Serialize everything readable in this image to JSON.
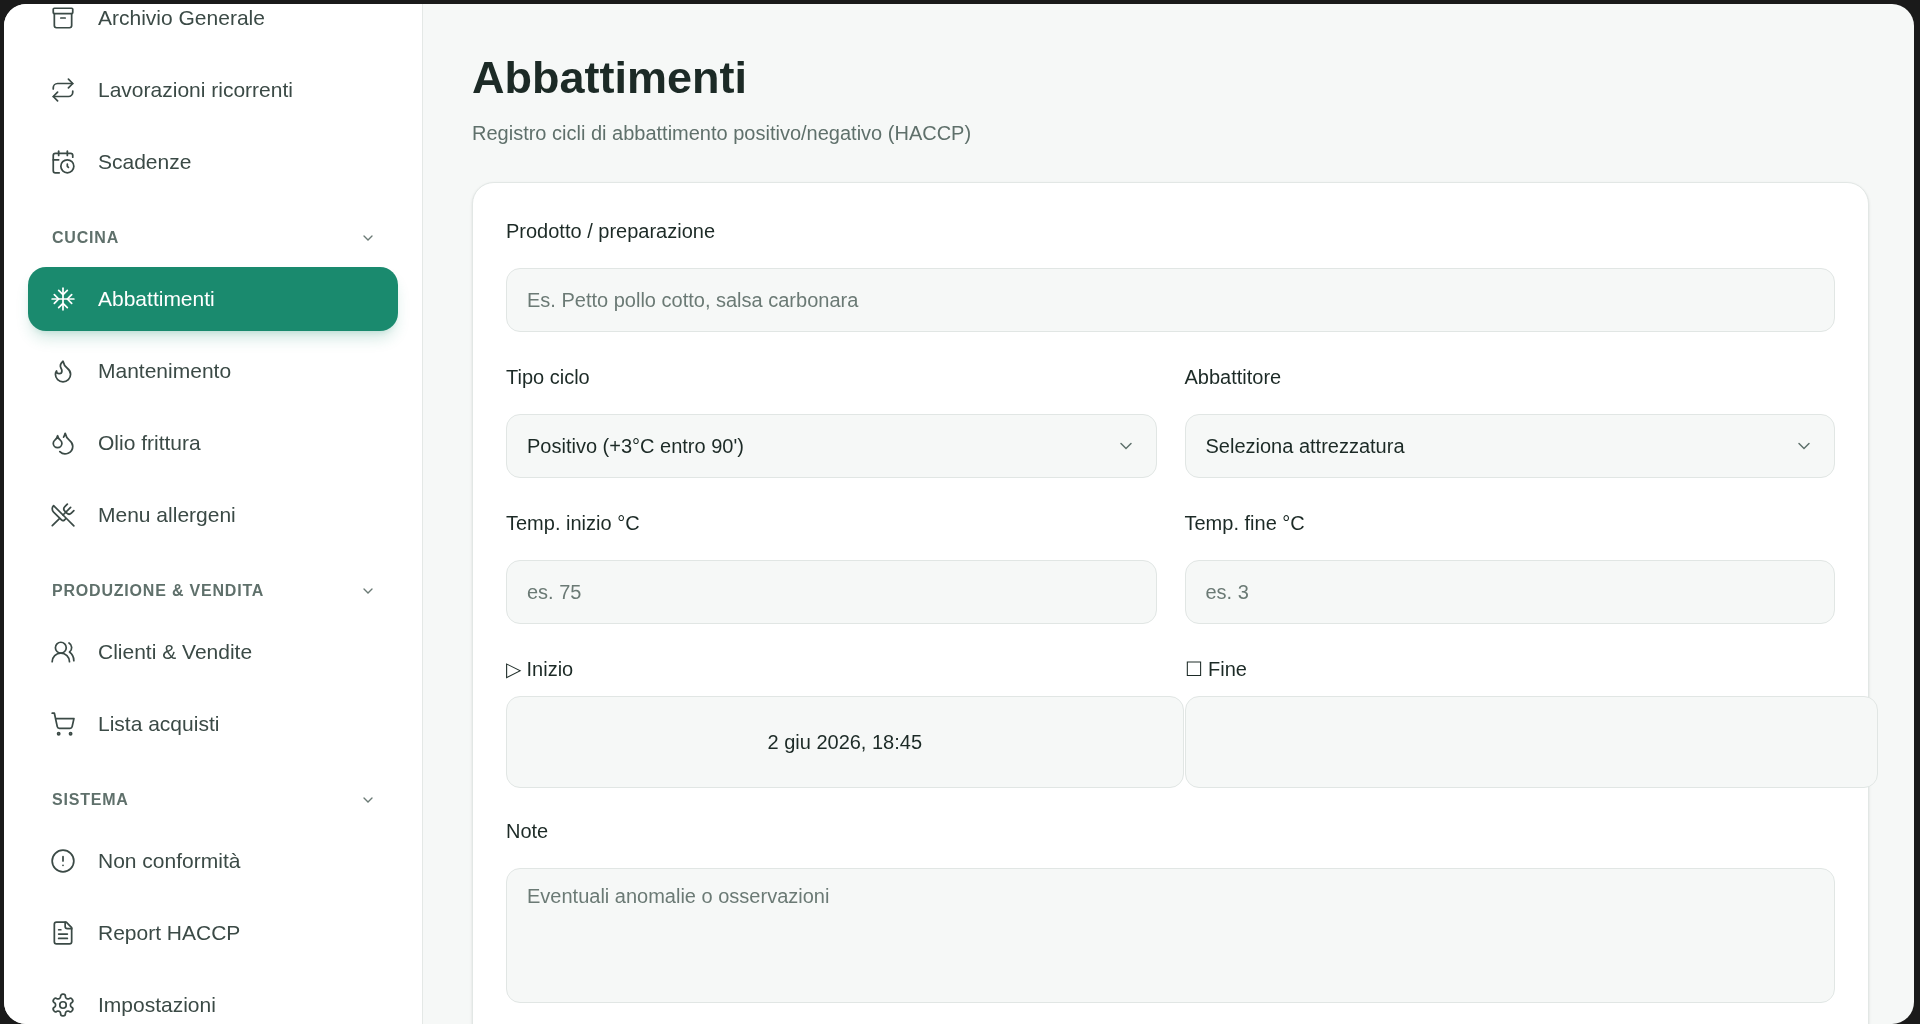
{
  "sidebar": {
    "items": [
      {
        "label": "Archivio Generale",
        "selected": false
      },
      {
        "label": "Lavorazioni ricorrenti",
        "selected": false
      },
      {
        "label": "Scadenze",
        "selected": false
      }
    ],
    "sections": [
      {
        "title": "CUCINA",
        "expanded": true,
        "items": [
          {
            "label": "Abbattimenti",
            "selected": true
          },
          {
            "label": "Mantenimento",
            "selected": false
          },
          {
            "label": "Olio frittura",
            "selected": false
          },
          {
            "label": "Menu allergeni",
            "selected": false
          }
        ]
      },
      {
        "title": "PRODUZIONE & VENDITA",
        "expanded": true,
        "items": [
          {
            "label": "Clienti & Vendite",
            "selected": false
          },
          {
            "label": "Lista acquisti",
            "selected": false
          }
        ]
      },
      {
        "title": "SISTEMA",
        "expanded": true,
        "items": [
          {
            "label": "Non conformità",
            "selected": false
          },
          {
            "label": "Report HACCP",
            "selected": false
          },
          {
            "label": "Impostazioni",
            "selected": false
          }
        ]
      }
    ]
  },
  "page": {
    "title": "Abbattimenti",
    "subtitle": "Registro cicli di abbattimento positivo/negativo (HACCP)"
  },
  "form": {
    "fields": [
      {
        "kind": "widetext",
        "label": "Prodotto / preparazione",
        "placeholder": "Es. Petto pollo cotto, salsa carbonara"
      },
      {
        "kind": "select",
        "label": "Tipo ciclo",
        "value": "Positivo (+3°C entro 90')"
      },
      {
        "kind": "select",
        "label": "Abbattitore",
        "value": "Seleziona attrezzatura"
      },
      {
        "kind": "text",
        "label": "Temp. inizio °C",
        "placeholder": "es. 75"
      },
      {
        "kind": "text",
        "label": "Temp. fine °C",
        "placeholder": "es. 3"
      },
      {
        "kind": "datetime",
        "label": "▷ Inizio",
        "value": "2 giu 2026, 18:45"
      },
      {
        "kind": "datetime",
        "label": "☐ Fine"
      },
      {
        "kind": "textarea",
        "label": "Note",
        "placeholder": "Eventuali anomalie o osservazioni"
      }
    ]
  }
}
